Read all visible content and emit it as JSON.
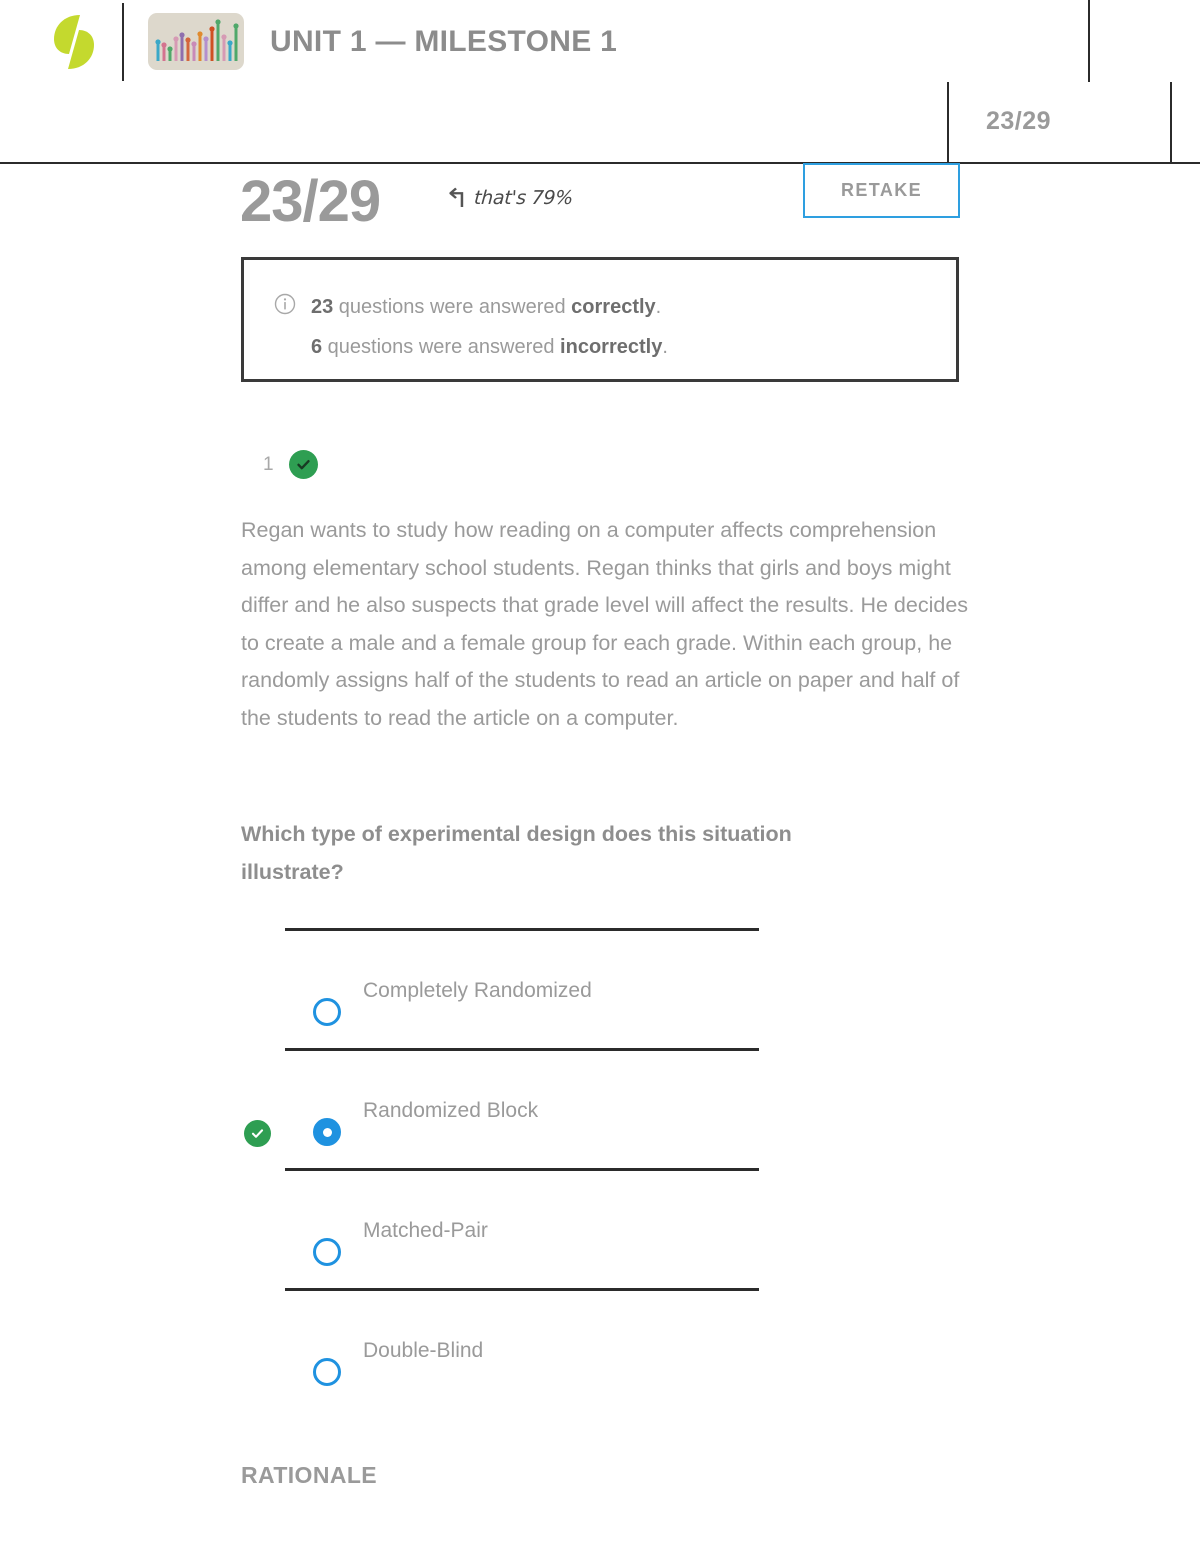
{
  "header": {
    "logo_name": "sophia-logo",
    "course_icon_name": "bar-chart-icon",
    "title": "UNIT 1 — MILESTONE 1",
    "score_badge": "23/29"
  },
  "score_row": {
    "score": "23/29",
    "annotation_arrow": "↰",
    "annotation_text": "that's 79%",
    "retake_label": "RETAKE"
  },
  "info_box": {
    "icon": "info-icon",
    "line1_count": "23",
    "line1_mid": " questions were answered ",
    "line1_emphasis": "correctly",
    "line1_end": ".",
    "line2_count": "6",
    "line2_mid": " questions were answered ",
    "line2_emphasis": "incorrectly",
    "line2_end": "."
  },
  "question": {
    "number": "1",
    "status": "correct",
    "status_icon": "check-icon",
    "body": "Regan wants to study how reading on a computer affects comprehension among elementary school students. Regan thinks that girls and boys might differ and he also suspects that grade level will affect the results.  He decides to create a male and a female group for each grade.  Within each group, he randomly assigns half of the students to read an article on paper and half of the students to read the article on a computer.",
    "prompt": "Which type of experimental design does this situation illustrate?",
    "options": [
      {
        "label": "Completely Randomized",
        "selected": false,
        "correct": false
      },
      {
        "label": "Randomized Block",
        "selected": true,
        "correct": true
      },
      {
        "label": "Matched-Pair",
        "selected": false,
        "correct": false
      },
      {
        "label": "Double-Blind",
        "selected": false,
        "correct": false
      }
    ]
  },
  "rationale": {
    "heading": "RATIONALE"
  },
  "colors": {
    "brand_green": "#c4d92e",
    "accent_blue": "#1f92e0",
    "retake_border": "#2e9fe0",
    "correct_green": "#2e9e52",
    "text_gray": "#9a9a9a",
    "rule_dark": "#2b2b2b",
    "icon_bg": "#ddd8cc"
  }
}
